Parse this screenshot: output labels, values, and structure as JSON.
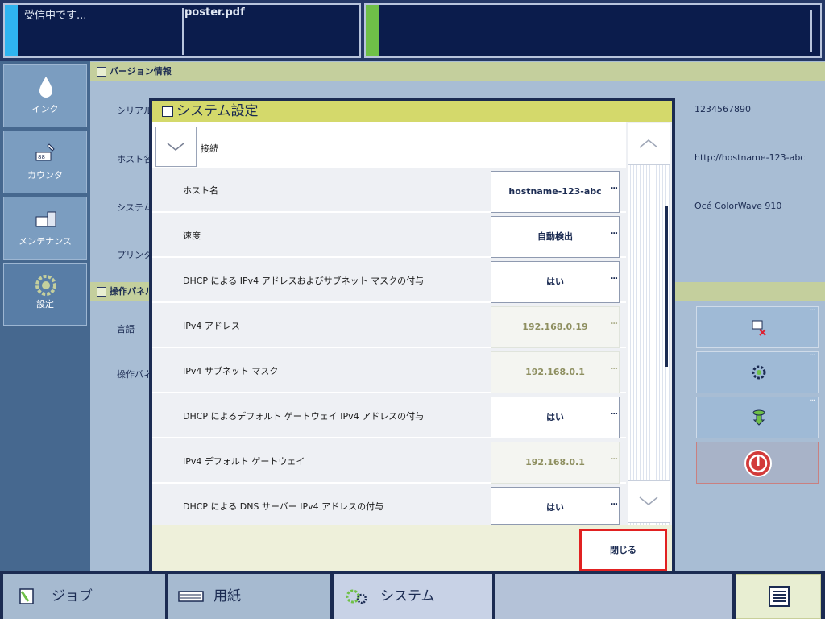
{
  "status": {
    "receiving": "受信中です...",
    "filename": "poster.pdf"
  },
  "nav": {
    "ink": "インク",
    "counter": "カウンタ",
    "maintenance": "メンテナンス",
    "settings": "設定"
  },
  "background": {
    "version_header": "バージョン情報",
    "rows": [
      {
        "label": "シリアル",
        "value": "1234567890"
      },
      {
        "label": "ホスト名",
        "value": "http://hostname-123-abc"
      },
      {
        "label": "システム",
        "value": "Océ ColorWave 910"
      },
      {
        "label": "プリンタ",
        "value": ""
      }
    ],
    "panel_header": "操作パネル",
    "panel_rows": [
      "言語",
      "操作パネ"
    ]
  },
  "dialog": {
    "title": "システム設定",
    "section": "接続",
    "rows": [
      {
        "label": "ホスト名",
        "value": "hostname-123-abc",
        "editable": true
      },
      {
        "label": "速度",
        "value": "自動検出",
        "editable": true
      },
      {
        "label": "DHCP による IPv4 アドレスおよびサブネット マスクの付与",
        "value": "はい",
        "editable": true
      },
      {
        "label": "IPv4 アドレス",
        "value": "192.168.0.19",
        "editable": false
      },
      {
        "label": "IPv4 サブネット マスク",
        "value": "192.168.0.1",
        "editable": false
      },
      {
        "label": "DHCP によるデフォルト ゲートウェイ IPv4 アドレスの付与",
        "value": "はい",
        "editable": true
      },
      {
        "label": "IPv4 デフォルト ゲートウェイ",
        "value": "192.168.0.1",
        "editable": false
      },
      {
        "label": "DHCP による DNS サーバー IPv4 アドレスの付与",
        "value": "はい",
        "editable": true
      }
    ],
    "more": "...",
    "close": "閉じる"
  },
  "bottom_tabs": {
    "jobs": "ジョブ",
    "paper": "用紙",
    "system": "システム"
  },
  "colors": {
    "navy": "#1b2b52",
    "highlight": "#e12121",
    "title_bar": "#d4d96b"
  }
}
